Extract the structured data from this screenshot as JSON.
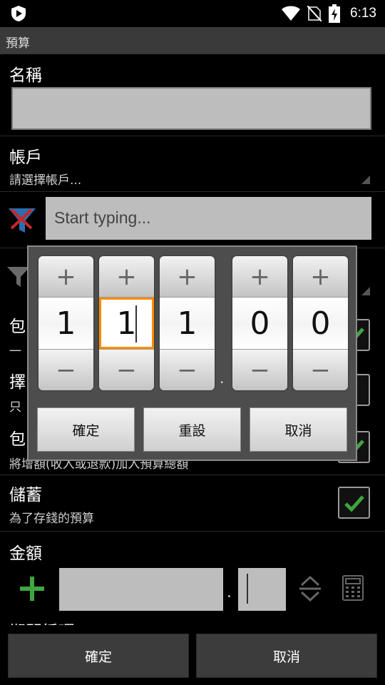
{
  "status_bar": {
    "time": "6:13"
  },
  "title_bar": {
    "title": "預算"
  },
  "form": {
    "name_label": "名稱",
    "account_label": "帳戶",
    "account_placeholder": "請選擇帳戶...",
    "filter_placeholder": "Start typing...",
    "row1_label_partial": "包",
    "row1_sub_partial": "一",
    "row2_label_partial": "擇",
    "row2_sub_partial": "只",
    "row3_label_partial": "包",
    "row3_sub": "將增額(收入或退款)加入預算總額",
    "savings_label": "儲蓄",
    "savings_sub": "為了存錢的預算",
    "savings_checked": true,
    "amount_label": "金額",
    "amount_decimal_separator": ".",
    "period_label_partial": "期間循環"
  },
  "dialog": {
    "digits": [
      {
        "value": "1"
      },
      {
        "value": "1",
        "focused": true
      },
      {
        "value": "1"
      },
      {
        "value": "0"
      },
      {
        "value": "0"
      }
    ],
    "increment_symbol": "+",
    "decrement_symbol": "−",
    "decimal_separator": ".",
    "buttons": {
      "confirm": "確定",
      "reset": "重設",
      "cancel": "取消"
    }
  },
  "bottom_buttons": {
    "confirm": "確定",
    "cancel": "取消"
  },
  "colors": {
    "focus_outline": "#ff8c00",
    "check_green": "#3fa63f",
    "filter_icon_blue": "#2a6fb0",
    "filter_icon_red": "#c62828"
  },
  "icons": [
    "app-shield-icon",
    "wifi-icon",
    "no-sim-icon",
    "battery-charging-icon",
    "filter-funnel-icon",
    "checkmark-icon",
    "plus-icon",
    "swap-vertical-icon",
    "calculator-icon"
  ]
}
